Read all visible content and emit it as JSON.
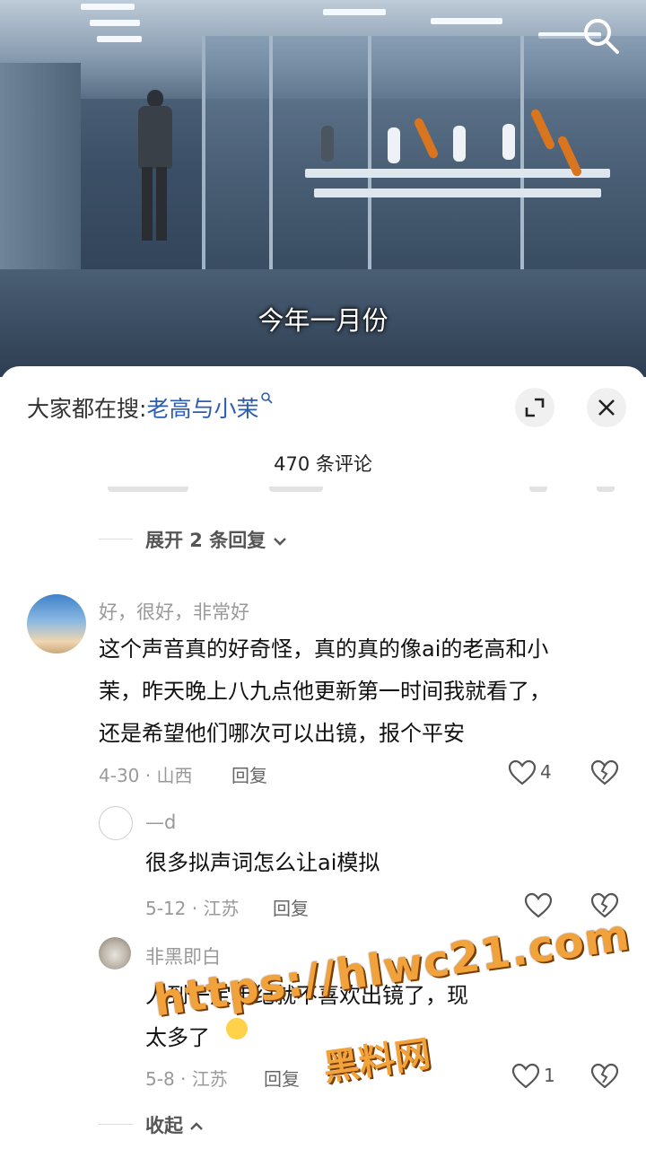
{
  "video": {
    "subtitle": "今年一月份",
    "search_icon": "search-icon"
  },
  "comment_sheet": {
    "hot_search_prefix": "大家都在搜:",
    "hot_search_keyword": "老高与小茉",
    "expand_icon": "expand-icon",
    "close_icon": "close-icon",
    "count_label": "470 条评论",
    "expand_replies_label": "展开 2 条回复",
    "collapse_label": "收起"
  },
  "comments": [
    {
      "user": "好，很好，非常好",
      "lines": [
        "这个声音真的好奇怪，真的真的像ai的老高和小",
        "茉，昨天晚上八九点他更新第一时间我就看了，",
        "还是希望他们哪次可以出镜，报个平安"
      ],
      "meta": "4-30 · 山西",
      "reply_label": "回复",
      "likes": "4"
    }
  ],
  "replies": [
    {
      "user": "—d",
      "text": "很多拟声词怎么让ai模拟",
      "meta": "5-12 · 江苏",
      "reply_label": "回复",
      "likes": ""
    },
    {
      "user": "非黑即白",
      "lines": [
        "人到一定年纪就不喜欢出镜了，现",
        "太多了"
      ],
      "meta": "5-8 · 江苏",
      "reply_label": "回复",
      "likes": "1"
    }
  ],
  "watermark": {
    "url": "https://hlwc21.com",
    "name": "黑料网"
  },
  "colors": {
    "keyword": "#2a5db0",
    "watermark": "#f2a23a"
  }
}
